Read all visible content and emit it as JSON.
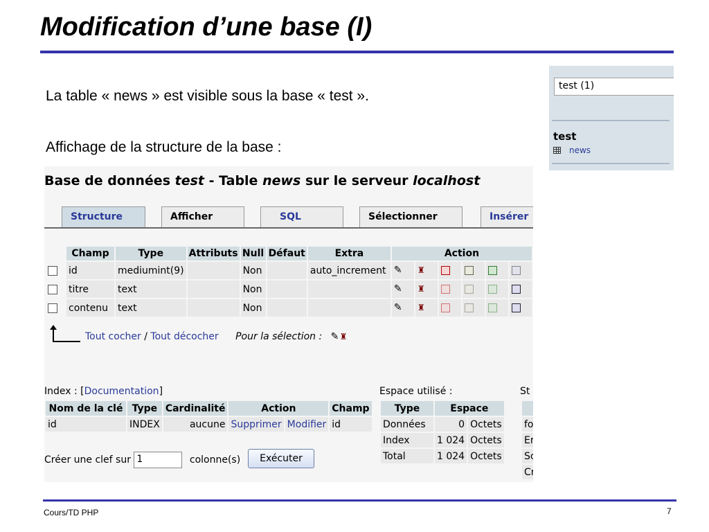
{
  "slide": {
    "title": "Modification d’une base (I)",
    "bullet1": "La table « news » est visible sous la base « test ».",
    "bullet2": "Affichage de la structure de la base :",
    "footer_left": "Cours/TD PHP",
    "page_number": "7"
  },
  "nav": {
    "select_value": "test (1)",
    "db_name": "test",
    "table_name": "news"
  },
  "shot": {
    "title_prefix": "Base de données ",
    "db": "test",
    "title_mid": " - Table ",
    "table": "news",
    "title_mid2": " sur le serveur ",
    "server": "localhost",
    "tabs": [
      "Structure",
      "Afficher",
      "SQL",
      "Sélectionner",
      "Insérer"
    ],
    "columns": [
      "Champ",
      "Type",
      "Attributs",
      "Null",
      "Défaut",
      "Extra",
      "Action"
    ],
    "rows": [
      {
        "champ": "id",
        "type": "mediumint(9)",
        "attributs": "",
        "null": "Non",
        "defaut": "",
        "extra": "auto_increment"
      },
      {
        "champ": "titre",
        "type": "text",
        "attributs": "",
        "null": "Non",
        "defaut": "",
        "extra": ""
      },
      {
        "champ": "contenu",
        "type": "text",
        "attributs": "",
        "null": "Non",
        "defaut": "",
        "extra": ""
      }
    ],
    "check_all": "Tout cocher",
    "separator": "/",
    "uncheck_all": "Tout décocher",
    "for_selection": "Pour la sélection :",
    "index": {
      "label_prefix": "Index : [",
      "doc_link": "Documentation",
      "label_suffix": "]",
      "columns": [
        "Nom de la clé",
        "Type",
        "Cardinalité",
        "Action",
        "Champ"
      ],
      "row": {
        "nom": "id",
        "type": "INDEX",
        "cardinalite": "aucune",
        "delete": "Supprimer",
        "modify": "Modifier",
        "champ": "id"
      }
    },
    "space": {
      "label": "Espace utilisé :",
      "columns": [
        "Type",
        "Espace"
      ],
      "rows": [
        {
          "type": "Données",
          "value": "0",
          "unit": "Octets"
        },
        {
          "type": "Index",
          "value": "1 024",
          "unit": "Octets"
        },
        {
          "type": "Total",
          "value": "1 024",
          "unit": "Octets"
        }
      ]
    },
    "stats": {
      "label": "St",
      "rows": [
        "fo",
        "Er",
        "Sc",
        "Cr"
      ]
    },
    "create_key": {
      "label": "Créer une clef sur",
      "value": "1",
      "suffix": "colonne(s)",
      "button": "Exécuter"
    }
  }
}
